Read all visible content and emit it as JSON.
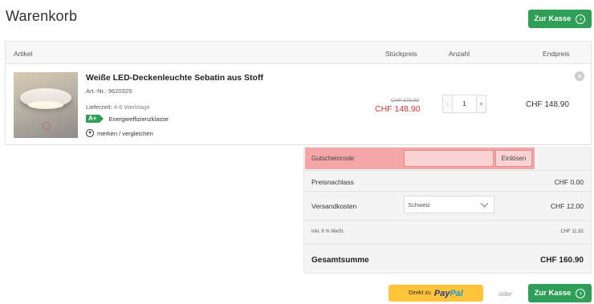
{
  "header": {
    "title": "Warenkorb",
    "checkout_label": "Zur Kasse",
    "checkout_icon": "chevron-right-icon"
  },
  "table": {
    "columns": {
      "artikel": "Artikel",
      "stueckpreis": "Stückpreis",
      "anzahl": "Anzahl",
      "endpreis": "Endpreis"
    }
  },
  "item": {
    "name": "Weiße LED-Deckenleuchte Sebatin aus Stoff",
    "art_nr": "Art.-Nr.: 9620329",
    "lieferzeit_label": "Lieferzeit:",
    "lieferzeit_value": "4-6 Werktage",
    "energy_badge": "A+",
    "energy_label": "Energieeffizienzklasse",
    "merken_label": "merken / vergleichen",
    "old_price": "CHF 175.90",
    "price": "CHF 148.90",
    "qty_minus": "-",
    "quantity": "1",
    "qty_plus": "+",
    "total": "CHF 148.90",
    "remove_icon": "close-icon"
  },
  "summary": {
    "coupon_label": "Gutscheincode",
    "coupon_placeholder": "",
    "coupon_button": "Einlösen",
    "preisnachlass_label": "Preisnachlass",
    "preisnachlass_value": "CHF 0.00",
    "versand_label": "Versandkosten",
    "versand_country": "Schweiz",
    "versand_value": "CHF 12.00",
    "mwst_label": "inkl. 8 % MwSt.",
    "mwst_value": "CHF 11.92",
    "total_label": "Gesamtsumme",
    "total_value": "CHF 160.90"
  },
  "footer": {
    "paypal_prefix": "Direkt zu",
    "paypal_brand_a": "Pay",
    "paypal_brand_b": "Pal",
    "oder": "oder",
    "checkout_label": "Zur Kasse"
  },
  "colors": {
    "accent": "#2f9e57",
    "sale_price": "#dd3333",
    "paypal": "#ffc439",
    "coupon_highlight": "#f4a6a6"
  }
}
